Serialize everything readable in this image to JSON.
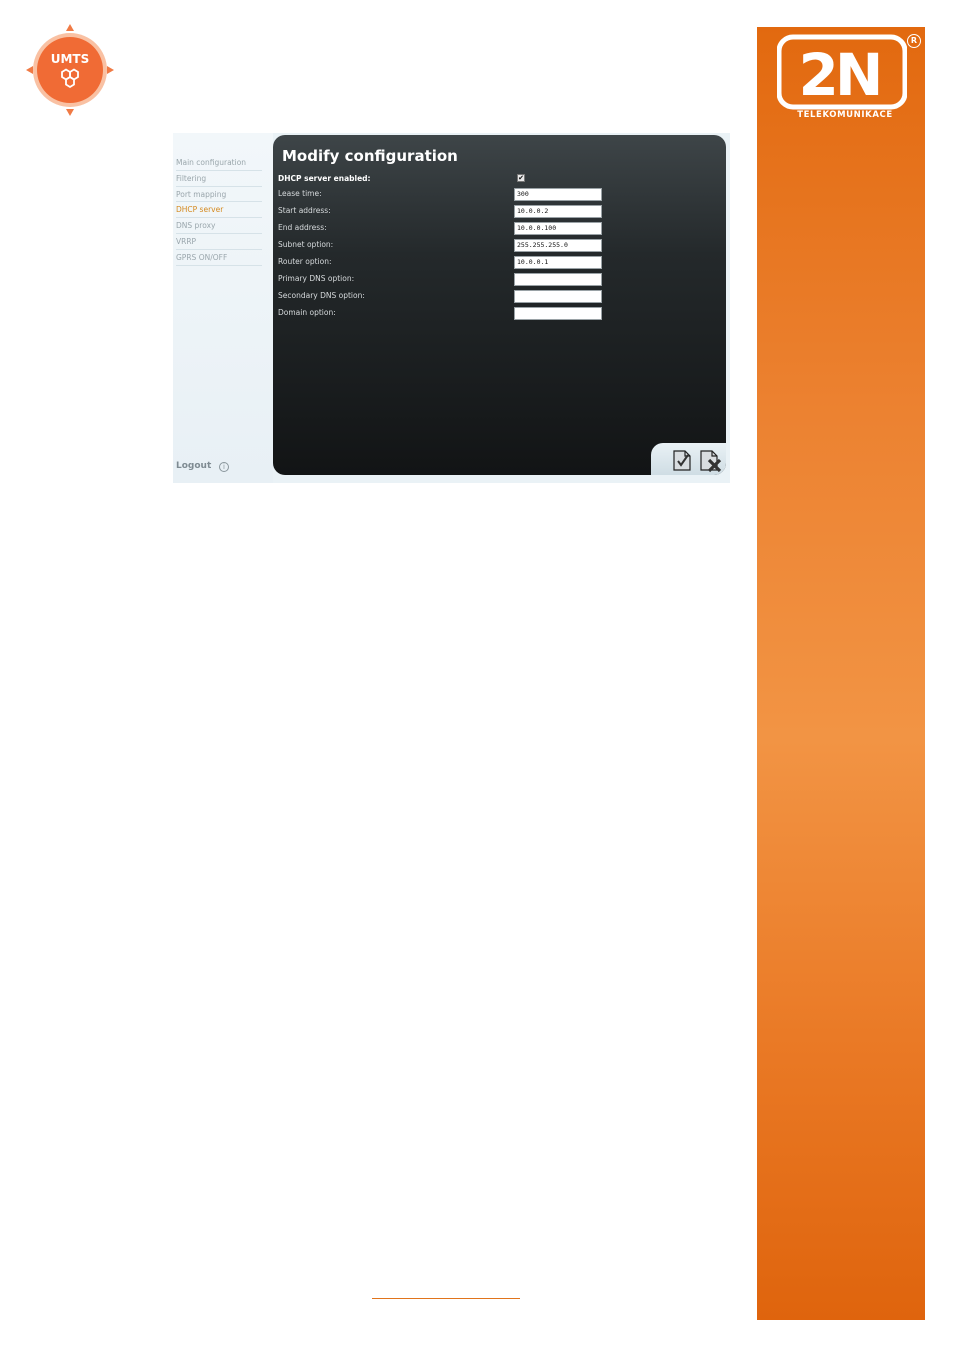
{
  "header": {
    "umts_logo_text": "UMTS",
    "brand_logo_text": "2N",
    "brand_registered": "R",
    "brand_tagline": "TELEKOMUNIKACE",
    "brand_color": "#e8761f"
  },
  "screenshot": {
    "sidebar": {
      "items": [
        {
          "label": "Main configuration",
          "active": false
        },
        {
          "label": "Filtering",
          "active": false
        },
        {
          "label": "Port mapping",
          "active": false
        },
        {
          "label": "DHCP server",
          "active": true
        },
        {
          "label": "DNS proxy",
          "active": false
        },
        {
          "label": "VRRP",
          "active": false
        },
        {
          "label": "GPRS ON/OFF",
          "active": false
        }
      ],
      "logout_label": "Logout",
      "logout_icon_glyph": "i"
    },
    "panel": {
      "title": "Modify configuration",
      "fields": {
        "dhcp_enabled": {
          "label": "DHCP server enabled:",
          "checked": true,
          "glyph": "✔"
        },
        "lease_time": {
          "label": "Lease time:",
          "value": "300"
        },
        "start_address": {
          "label": "Start address:",
          "value": "10.0.0.2"
        },
        "end_address": {
          "label": "End address:",
          "value": "10.0.0.100"
        },
        "subnet_option": {
          "label": "Subnet option:",
          "value": "255.255.255.0"
        },
        "router_option": {
          "label": "Router option:",
          "value": "10.0.0.1"
        },
        "primary_dns": {
          "label": "Primary DNS option:",
          "value": ""
        },
        "secondary_dns": {
          "label": "Secondary DNS option:",
          "value": ""
        },
        "domain_option": {
          "label": "Domain option:",
          "value": ""
        }
      },
      "footer_icons": [
        "save-icon",
        "cancel-icon"
      ]
    }
  }
}
